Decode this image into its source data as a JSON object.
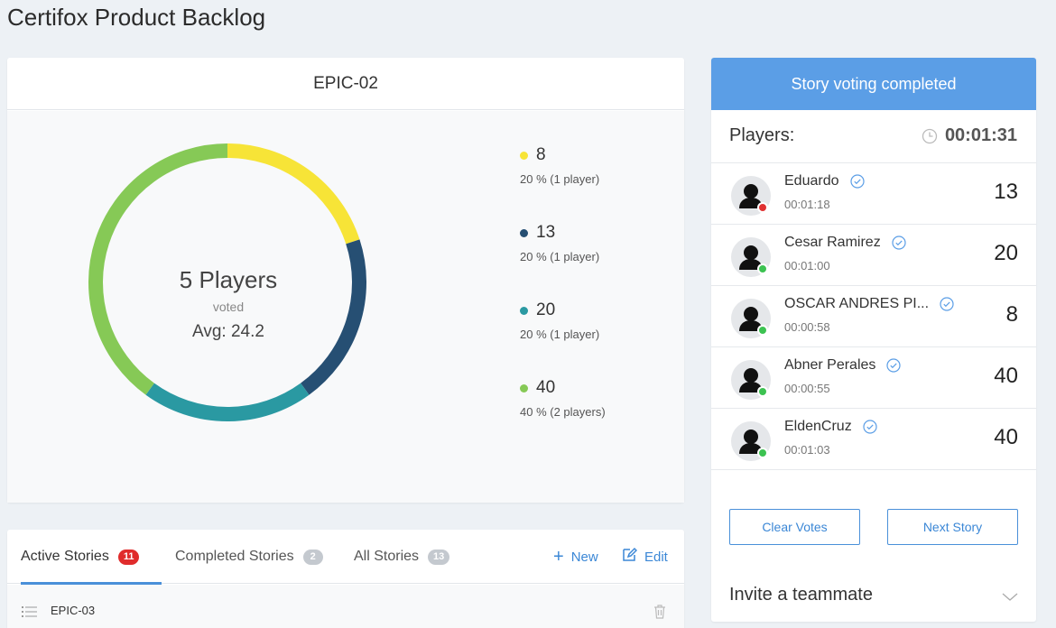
{
  "page": {
    "title": "Certifox Product Backlog"
  },
  "chart_card": {
    "title": "EPIC-02",
    "center": {
      "players": "5 Players",
      "voted": "voted",
      "avg": "Avg: 24.2"
    }
  },
  "chart_data": {
    "type": "pie",
    "donut": true,
    "start_angle_deg": 0,
    "direction": "clockwise",
    "series": [
      {
        "name": "8",
        "count": 1,
        "percent": 20,
        "label": "20 % (1 player)",
        "color": "#f7e437"
      },
      {
        "name": "13",
        "count": 1,
        "percent": 20,
        "label": "20 % (1 player)",
        "color": "#264f73"
      },
      {
        "name": "20",
        "count": 1,
        "percent": 20,
        "label": "20 % (1 player)",
        "color": "#2a99a2"
      },
      {
        "name": "40",
        "count": 2,
        "percent": 40,
        "label": "40 % (2 players)",
        "color": "#86c956"
      }
    ],
    "legend_placement": "right"
  },
  "stories": {
    "tabs": [
      {
        "label": "Active Stories",
        "count": "11",
        "active": true
      },
      {
        "label": "Completed Stories",
        "count": "2",
        "active": false
      },
      {
        "label": "All Stories",
        "count": "13",
        "active": false
      }
    ],
    "new_label": "New",
    "edit_label": "Edit",
    "items": [
      {
        "title": "EPIC-03"
      }
    ]
  },
  "voting": {
    "banner": "Story voting completed",
    "players_label": "Players:",
    "timer": "00:01:31",
    "players": [
      {
        "name": "Eduardo",
        "time": "00:01:18",
        "vote": "13",
        "status_color": "#e03131"
      },
      {
        "name": "Cesar Ramirez",
        "time": "00:01:00",
        "vote": "20",
        "status_color": "#3cc251"
      },
      {
        "name": "OSCAR ANDRES PI...",
        "time": "00:00:58",
        "vote": "8",
        "status_color": "#3cc251"
      },
      {
        "name": "Abner Perales",
        "time": "00:00:55",
        "vote": "40",
        "status_color": "#3cc251"
      },
      {
        "name": "EldenCruz",
        "time": "00:01:03",
        "vote": "40",
        "status_color": "#3cc251"
      }
    ],
    "clear_votes_label": "Clear Votes",
    "next_story_label": "Next Story",
    "invite_label": "Invite a teammate"
  },
  "colors": {
    "accent": "#4a90d9",
    "banner": "#5b9ee6",
    "badge_active": "#e02c2c",
    "badge_inactive": "#c4c9cf"
  },
  "icons": {
    "new": "plus-icon",
    "edit": "edit-icon",
    "timer": "clock-icon",
    "verified": "check-circle-icon",
    "list": "list-icon",
    "delete": "trash-icon",
    "expand": "chevron-down-icon",
    "avatar": "user-avatar-icon"
  }
}
